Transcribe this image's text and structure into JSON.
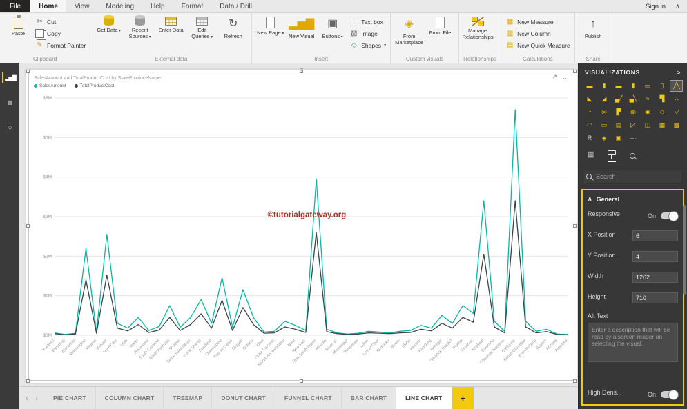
{
  "ribbon": {
    "sign_in": "Sign in",
    "collapse_glyph": "∧",
    "tabs": [
      {
        "label": "File",
        "file": true
      },
      {
        "label": "Home",
        "active": true
      },
      {
        "label": "View"
      },
      {
        "label": "Modeling"
      },
      {
        "label": "Help"
      },
      {
        "label": "Format"
      },
      {
        "label": "Data / Drill"
      }
    ],
    "groups": [
      {
        "label": "Clipboard",
        "big": [
          {
            "label": "Paste",
            "icon": "paste",
            "css": "icp-clip"
          }
        ],
        "small": [
          {
            "label": "Cut",
            "icon": "scissors",
            "glyph": "✂",
            "color": "#666666"
          },
          {
            "label": "Copy",
            "icon": "copy",
            "css": "icp-copy"
          },
          {
            "label": "Format Painter",
            "icon": "format-painter",
            "glyph": "✎",
            "color": "#c79a09"
          }
        ]
      },
      {
        "label": "External data",
        "big": [
          {
            "label": "Get Data",
            "icon": "get-data",
            "css": "icp-db",
            "caret": true
          },
          {
            "label": "Recent Sources",
            "icon": "recent-sources",
            "css": "icp-db gray",
            "caret": true
          },
          {
            "label": "Enter Data",
            "icon": "enter-data",
            "css": "icp-table"
          },
          {
            "label": "Edit Queries",
            "icon": "edit-queries",
            "css": "icp-table gray",
            "caret": true
          },
          {
            "label": "Refresh",
            "icon": "refresh",
            "glyph": "↻",
            "color": "#555555"
          }
        ]
      },
      {
        "label": "Insert",
        "big": [
          {
            "label": "New Page",
            "icon": "new-page",
            "css": "icp-page",
            "caret": true
          },
          {
            "label": "New Visual",
            "icon": "new-visual",
            "glyph": "▂▅▇",
            "color": "#e0a800"
          },
          {
            "label": "Buttons",
            "icon": "buttons",
            "glyph": "▣",
            "color": "#666666",
            "caret": true
          }
        ],
        "small": [
          {
            "label": "Text box",
            "icon": "text-box",
            "glyph": "Ξ",
            "color": "#666666"
          },
          {
            "label": "Image",
            "icon": "image",
            "glyph": "▨",
            "color": "#666666"
          },
          {
            "label": "Shapes",
            "icon": "shapes",
            "glyph": "◇",
            "color": "#2f8f6b",
            "caret": true
          }
        ]
      },
      {
        "label": "Custom visuals",
        "big": [
          {
            "label": "From Marketplace",
            "icon": "from-marketplace",
            "glyph": "◈",
            "color": "#e0a800"
          },
          {
            "label": "From File",
            "icon": "from-file",
            "css": "icp-page"
          }
        ]
      },
      {
        "label": "Relationships",
        "big": [
          {
            "label": "Manage Relationships",
            "icon": "manage-relationships",
            "css": "icp-rel"
          }
        ]
      },
      {
        "label": "Calculations",
        "small": [
          {
            "label": "New Measure",
            "icon": "new-measure",
            "glyph": "▦",
            "color": "#e0a800"
          },
          {
            "label": "New Column",
            "icon": "new-column",
            "glyph": "▥",
            "color": "#e0a800"
          },
          {
            "label": "New Quick Measure",
            "icon": "new-quick-measure",
            "glyph": "▤",
            "color": "#e0a800"
          }
        ]
      },
      {
        "label": "Share",
        "big": [
          {
            "label": "Publish",
            "icon": "publish",
            "glyph": "↑",
            "color": "#555555"
          }
        ]
      }
    ]
  },
  "left_nav": {
    "active": "report-view",
    "items": [
      {
        "name": "report-view",
        "glyph": "▂▅▇"
      },
      {
        "name": "data-view",
        "glyph": "▦"
      },
      {
        "name": "model-view",
        "glyph": "◇"
      }
    ]
  },
  "selection": {
    "grip_glyph": "≡",
    "focus_glyph": "↗",
    "more_glyph": "…"
  },
  "chart_data": {
    "type": "line",
    "title": "SalesAmount and TotalProductCost by StateProvinceName",
    "xlabel": "StateProvinceName",
    "ylabel": "",
    "ylim_millions": [
      0,
      6
    ],
    "y_tick_labels": [
      "$0M",
      "$1M",
      "$2M",
      "$3M",
      "$4M",
      "$5M",
      "$6M"
    ],
    "grid": true,
    "legend_position": "top-left",
    "watermark": "©tutorialgateway.org",
    "categories": [
      "Yvelines",
      "Wyoming",
      "Wisconsin",
      "Washington",
      "Virginia",
      "Victoria",
      "Val d'Oise",
      "Utah",
      "Texas",
      "Tennessee",
      "South Carolina",
      "South Australia",
      "Somme",
      "Seine Saint Denis",
      "Seine (Paris)",
      "Saarland",
      "Queensland",
      "Pas de Calais",
      "Oregon",
      "Ontario",
      "Ohio",
      "North Carolina",
      "Nordrhein Westfalen",
      "Nord",
      "New York",
      "New South Wales",
      "Moselle",
      "Missouri",
      "Mississippi",
      "Minnesota",
      "Loiret",
      "Loir et Cher",
      "Kentucky",
      "Illinois",
      "Idaho",
      "Hessen",
      "Hamburg",
      "Georgia",
      "Garonne (Haute)",
      "Florida",
      "Essonne",
      "England",
      "Colorado",
      "Charente Maritime",
      "California",
      "British Columbia",
      "Brandenburg",
      "Bayern",
      "Arizona",
      "Alabama"
    ],
    "series": [
      {
        "name": "SalesAmount",
        "color": "#01b8aa",
        "values_millions": [
          0.06,
          0.02,
          0.05,
          2.2,
          0.08,
          2.55,
          0.3,
          0.18,
          0.45,
          0.12,
          0.22,
          0.75,
          0.2,
          0.45,
          0.9,
          0.3,
          1.45,
          0.2,
          1.15,
          0.45,
          0.08,
          0.1,
          0.35,
          0.25,
          0.12,
          3.95,
          0.15,
          0.06,
          0.03,
          0.05,
          0.1,
          0.08,
          0.06,
          0.1,
          0.12,
          0.25,
          0.18,
          0.5,
          0.3,
          0.75,
          0.55,
          3.4,
          0.35,
          0.1,
          5.7,
          0.35,
          0.1,
          0.15,
          0.03,
          0.02
        ]
      },
      {
        "name": "TotalProductCost",
        "color": "#374649",
        "values_millions": [
          0.04,
          0.01,
          0.03,
          1.4,
          0.05,
          1.52,
          0.18,
          0.11,
          0.27,
          0.07,
          0.13,
          0.45,
          0.12,
          0.27,
          0.54,
          0.18,
          0.88,
          0.12,
          0.7,
          0.27,
          0.05,
          0.06,
          0.21,
          0.15,
          0.07,
          2.6,
          0.09,
          0.04,
          0.02,
          0.03,
          0.06,
          0.05,
          0.04,
          0.06,
          0.07,
          0.15,
          0.11,
          0.3,
          0.18,
          0.45,
          0.33,
          2.05,
          0.21,
          0.06,
          3.4,
          0.21,
          0.06,
          0.09,
          0.02,
          0.01
        ]
      }
    ]
  },
  "page_tabs": {
    "prev_glyph": "‹",
    "next_glyph": "›",
    "items": [
      "PIE CHART",
      "COLUMN CHART",
      "TREEMAP",
      "DONUT CHART",
      "FUNNEL CHART",
      "BAR CHART",
      "LINE CHART"
    ],
    "active": "LINE CHART",
    "add_label": "+"
  },
  "visualizations": {
    "title": "VISUALIZATIONS",
    "collapse_glyph": ">",
    "search_placeholder": "Search",
    "accent_color": "#f2c811",
    "pane_tabs": [
      {
        "name": "fields",
        "glyph": "▦"
      },
      {
        "name": "format",
        "css": "icx-roller",
        "active": true
      },
      {
        "name": "analytics",
        "css": "icx-mag"
      }
    ],
    "tiles": [
      {
        "name": "stacked-bar-chart",
        "glyph": "▬"
      },
      {
        "name": "stacked-column-chart",
        "glyph": "▮"
      },
      {
        "name": "clustered-bar-chart",
        "glyph": "▬"
      },
      {
        "name": "clustered-column-chart",
        "glyph": "▮"
      },
      {
        "name": "100-stacked-bar-chart",
        "glyph": "▭"
      },
      {
        "name": "100-stacked-column-chart",
        "glyph": "▯"
      },
      {
        "name": "line-chart",
        "glyph": "╱╲",
        "selected": true
      },
      {
        "name": "area-chart",
        "glyph": "◣"
      },
      {
        "name": "stacked-area-chart",
        "glyph": "◢"
      },
      {
        "name": "line-and-stacked-column-chart",
        "glyph": "▄╱"
      },
      {
        "name": "line-and-clustered-column-chart",
        "glyph": "▄╲"
      },
      {
        "name": "ribbon-chart",
        "glyph": "≈"
      },
      {
        "name": "waterfall-chart",
        "glyph": "▜"
      },
      {
        "name": "scatter-chart",
        "glyph": "∴"
      },
      {
        "name": "pie-chart",
        "glyph": "◔"
      },
      {
        "name": "donut-chart",
        "glyph": "◎"
      },
      {
        "name": "treemap",
        "glyph": "▛"
      },
      {
        "name": "map",
        "glyph": "◍"
      },
      {
        "name": "filled-map",
        "glyph": "◉"
      },
      {
        "name": "shape-map",
        "glyph": "◇"
      },
      {
        "name": "funnel-chart",
        "glyph": "▽"
      },
      {
        "name": "gauge",
        "glyph": "◠"
      },
      {
        "name": "card",
        "glyph": "▭"
      },
      {
        "name": "multi-row-card",
        "glyph": "▤"
      },
      {
        "name": "kpi",
        "glyph": "◸"
      },
      {
        "name": "slicer",
        "glyph": "◫"
      },
      {
        "name": "table",
        "glyph": "▦"
      },
      {
        "name": "matrix",
        "glyph": "▩"
      },
      {
        "name": "r-script-visual",
        "glyph": "R",
        "color": "#d6d6d6"
      },
      {
        "name": "arcgis-map",
        "glyph": "◈"
      },
      {
        "name": "custom-visual",
        "glyph": "▣"
      },
      {
        "name": "more-visuals",
        "glyph": "⋯",
        "color": "#d6d6d6"
      }
    ]
  },
  "format_pane": {
    "section": "General",
    "collapse_glyph": "∧",
    "rows": [
      {
        "label": "Responsive",
        "type": "toggle",
        "state": "On"
      },
      {
        "label": "X Position",
        "type": "input",
        "value": "6"
      },
      {
        "label": "Y Position",
        "type": "input",
        "value": "4"
      },
      {
        "label": "Width",
        "type": "input",
        "value": "1262"
      },
      {
        "label": "Height",
        "type": "input",
        "value": "710"
      },
      {
        "label": "Alt Text",
        "type": "textarea",
        "placeholder": "Enter a description that will be read by a screen reader on selecting the visual."
      },
      {
        "label": "High Dens...",
        "type": "toggle",
        "state": "On",
        "pin": "bottom"
      }
    ]
  }
}
